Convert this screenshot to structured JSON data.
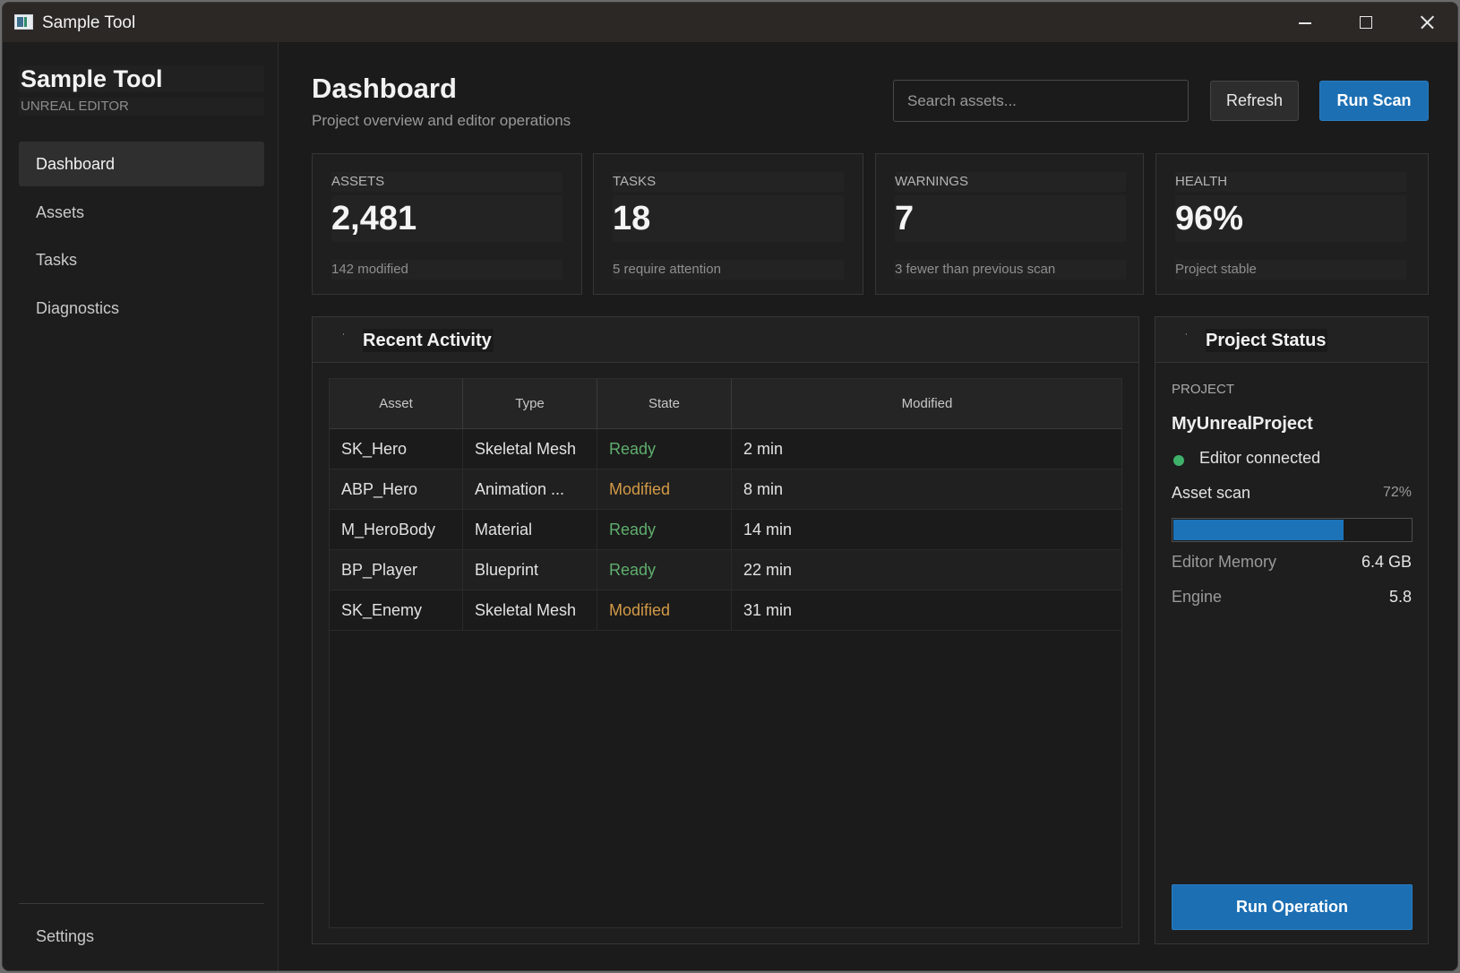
{
  "window": {
    "title": "Sample Tool"
  },
  "sidebar": {
    "brand_title": "Sample Tool",
    "brand_subtitle": "UNREAL EDITOR",
    "items": [
      {
        "label": "Dashboard",
        "active": true
      },
      {
        "label": "Assets",
        "active": false
      },
      {
        "label": "Tasks",
        "active": false
      },
      {
        "label": "Diagnostics",
        "active": false
      }
    ],
    "settings_label": "Settings"
  },
  "header": {
    "title": "Dashboard",
    "subtitle": "Project overview and editor operations",
    "search_placeholder": "Search assets...",
    "refresh_label": "Refresh",
    "run_scan_label": "Run Scan"
  },
  "stats": [
    {
      "label": "ASSETS",
      "value": "2,481",
      "note": "142 modified"
    },
    {
      "label": "TASKS",
      "value": "18",
      "note": "5 require attention"
    },
    {
      "label": "WARNINGS",
      "value": "7",
      "note": "3 fewer than previous scan"
    },
    {
      "label": "HEALTH",
      "value": "96%",
      "note": "Project stable"
    }
  ],
  "activity": {
    "title": "Recent Activity",
    "columns": [
      "Asset",
      "Type",
      "State",
      "Modified"
    ],
    "rows": [
      {
        "asset": "SK_Hero",
        "type": "Skeletal Mesh",
        "state": "Ready",
        "modified": "2 min"
      },
      {
        "asset": "ABP_Hero",
        "type": "Animation ...",
        "state": "Modified",
        "modified": "8 min"
      },
      {
        "asset": "M_HeroBody",
        "type": "Material",
        "state": "Ready",
        "modified": "14 min"
      },
      {
        "asset": "BP_Player",
        "type": "Blueprint",
        "state": "Ready",
        "modified": "22 min"
      },
      {
        "asset": "SK_Enemy",
        "type": "Skeletal Mesh",
        "state": "Modified",
        "modified": "31 min"
      }
    ]
  },
  "project_status": {
    "title": "Project Status",
    "label": "PROJECT",
    "name": "MyUnrealProject",
    "connection": "Editor connected",
    "scan_label": "Asset scan",
    "scan_percent_text": "72%",
    "scan_progress": 0.72,
    "memory_label": "Editor Memory",
    "memory_value": "6.4 GB",
    "engine_label": "Engine",
    "engine_value": "5.8",
    "run_operation_label": "Run Operation"
  },
  "colors": {
    "accent": "#1c6fb3",
    "ready": "#5fae6e",
    "modified": "#d39a46",
    "connected": "#3fb16a"
  }
}
